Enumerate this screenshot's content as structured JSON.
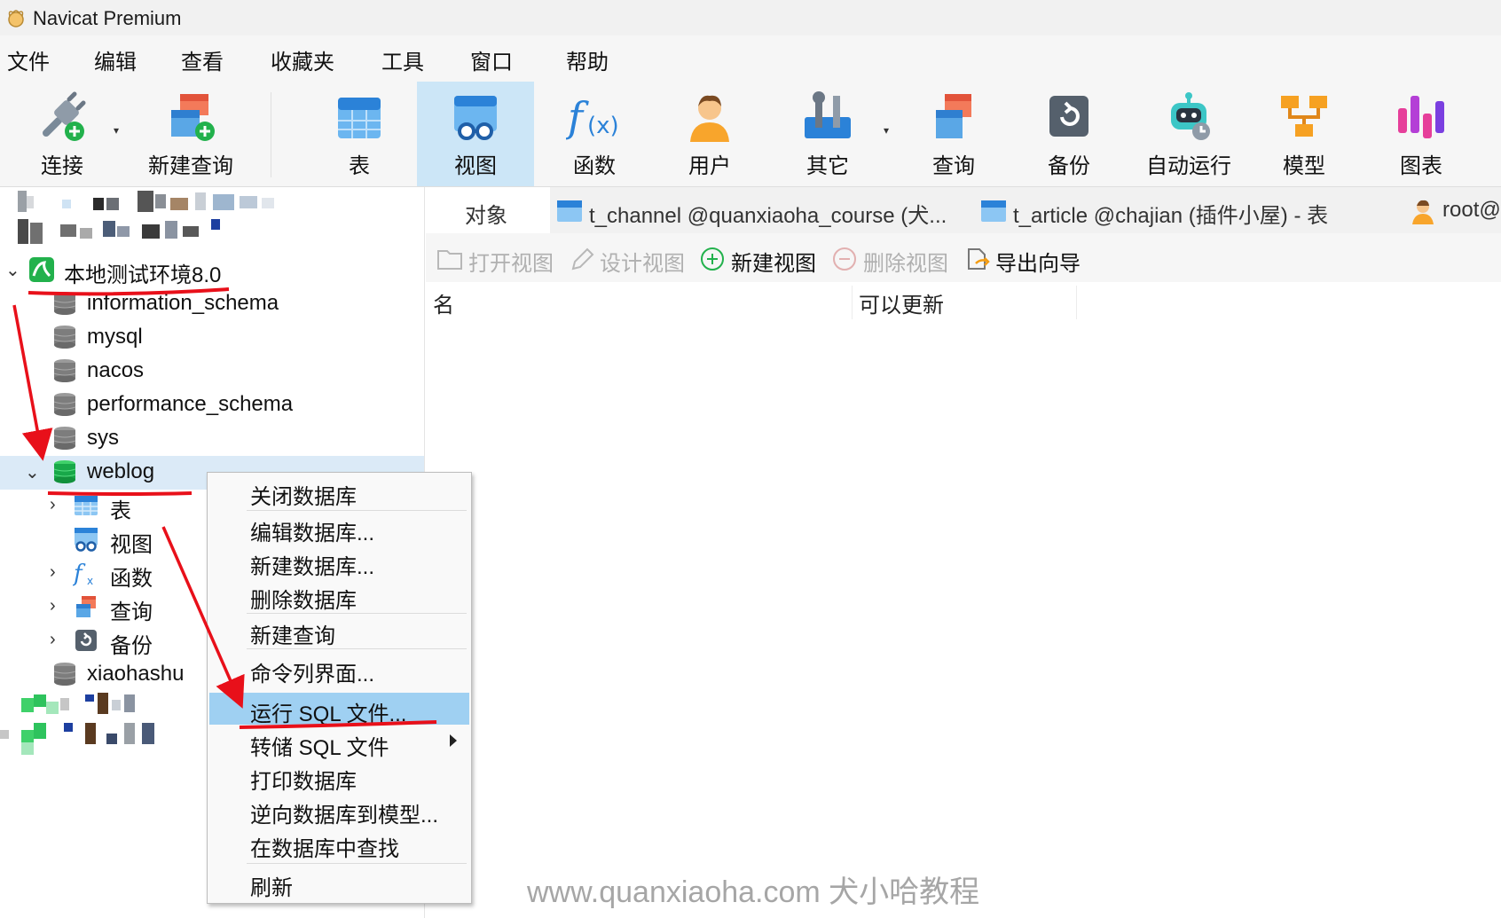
{
  "window": {
    "title": "Navicat Premium"
  },
  "menu": [
    "文件",
    "编辑",
    "查看",
    "收藏夹",
    "工具",
    "窗口",
    "帮助"
  ],
  "toolbar": [
    {
      "label": "连接",
      "icon": "plug-add-icon"
    },
    {
      "label": "新建查询",
      "icon": "new-query-icon"
    },
    {
      "label": "表",
      "icon": "table-icon"
    },
    {
      "label": "视图",
      "icon": "view-icon"
    },
    {
      "label": "函数",
      "icon": "function-icon"
    },
    {
      "label": "用户",
      "icon": "user-icon"
    },
    {
      "label": "其它",
      "icon": "tools-icon"
    },
    {
      "label": "查询",
      "icon": "query-icon"
    },
    {
      "label": "备份",
      "icon": "backup-icon"
    },
    {
      "label": "自动运行",
      "icon": "robot-icon"
    },
    {
      "label": "模型",
      "icon": "model-icon"
    },
    {
      "label": "图表",
      "icon": "chart-icon"
    }
  ],
  "tree": {
    "connection": "本地测试环境8.0",
    "databases": [
      "information_schema",
      "mysql",
      "nacos",
      "performance_schema",
      "sys"
    ],
    "open_db": "weblog",
    "children": [
      "表",
      "视图",
      "函数",
      "查询",
      "备份"
    ],
    "after": "xiaohashu"
  },
  "tabs": {
    "objects": "对象",
    "tab1": "t_channel @quanxiaoha_course (犬...",
    "tab2": "t_article @chajian (插件小屋) - 表",
    "tab3": "root@"
  },
  "object_toolbar": {
    "open_view": "打开视图",
    "design_view": "设计视图",
    "new_view": "新建视图",
    "delete_view": "删除视图",
    "export_wizard": "导出向导"
  },
  "columns": {
    "name": "名",
    "updatable": "可以更新"
  },
  "context_menu": [
    "关闭数据库",
    "编辑数据库...",
    "新建数据库...",
    "删除数据库",
    "新建查询",
    "命令列界面...",
    "运行 SQL 文件...",
    "转储 SQL 文件",
    "打印数据库",
    "逆向数据库到模型...",
    "在数据库中查找",
    "刷新"
  ],
  "highlighted_menu_item": "运行 SQL 文件...",
  "watermark": "www.quanxiaoha.com 犬小哈教程",
  "colors": {
    "annotation": "#e8101a",
    "selection": "#dbeaf7",
    "menu_highlight": "#9fd0f2",
    "toolbar_active": "#cce6f7"
  }
}
